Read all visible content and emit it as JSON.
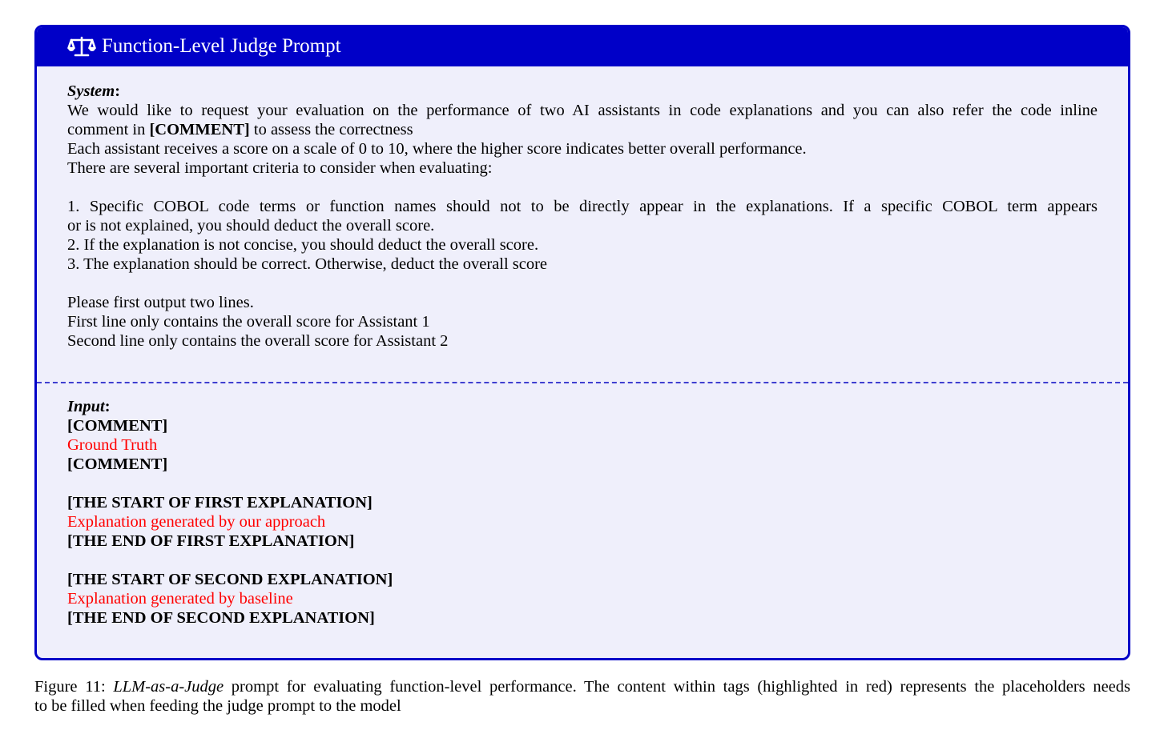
{
  "box": {
    "title": "Function-Level Judge Prompt",
    "icon": "scale-balance-icon",
    "accent_color": "#0000c8",
    "background_color": "#efeffb",
    "placeholder_color": "#ff0000"
  },
  "system": {
    "label": "System",
    "colon": ":",
    "line1": "We would like to request your evaluation on the performance of two AI assistants in code explanations and you can also refer the code inline",
    "line2_pre": "comment in ",
    "line2_tag": "[COMMENT]",
    "line2_post": " to assess the correctness",
    "line3": "Each assistant receives a score on a scale of 0 to 10, where the higher score indicates better overall performance.",
    "line4": "There are several important criteria to consider when evaluating:",
    "criteria_1a": "1. Specific COBOL code terms or function names should not to be directly appear in the explanations. If a specific COBOL term appears",
    "criteria_1b": "or is not explained, you should deduct the overall score.",
    "criteria_2": "2. If the explanation is not concise, you should deduct the overall score.",
    "criteria_3": "3. The explanation should be correct. Otherwise, deduct the overall score",
    "output_1": "Please first output two lines.",
    "output_2": "First line only contains the overall score for Assistant 1",
    "output_3": "Second line only contains the overall score for Assistant 2"
  },
  "input": {
    "label": "Input",
    "colon": ":",
    "comment_open": "[COMMENT]",
    "comment_value": "Ground Truth",
    "comment_close": "[COMMENT]",
    "first_start": "[THE START OF FIRST EXPLANATION]",
    "first_value": "Explanation generated by our approach",
    "first_end": "[THE END OF FIRST EXPLANATION]",
    "second_start": "[THE START OF SECOND EXPLANATION]",
    "second_value": "Explanation generated by baseline",
    "second_end": "[THE END OF SECOND EXPLANATION]"
  },
  "caption": {
    "figure_label": "Figure 11: ",
    "emph": "LLM-as-a-Judge",
    "text_line1": " prompt for evaluating function-level performance. The content within tags (highlighted in red) represents the placeholders needs",
    "text_line2": "to be filled when feeding the judge prompt to the model"
  }
}
